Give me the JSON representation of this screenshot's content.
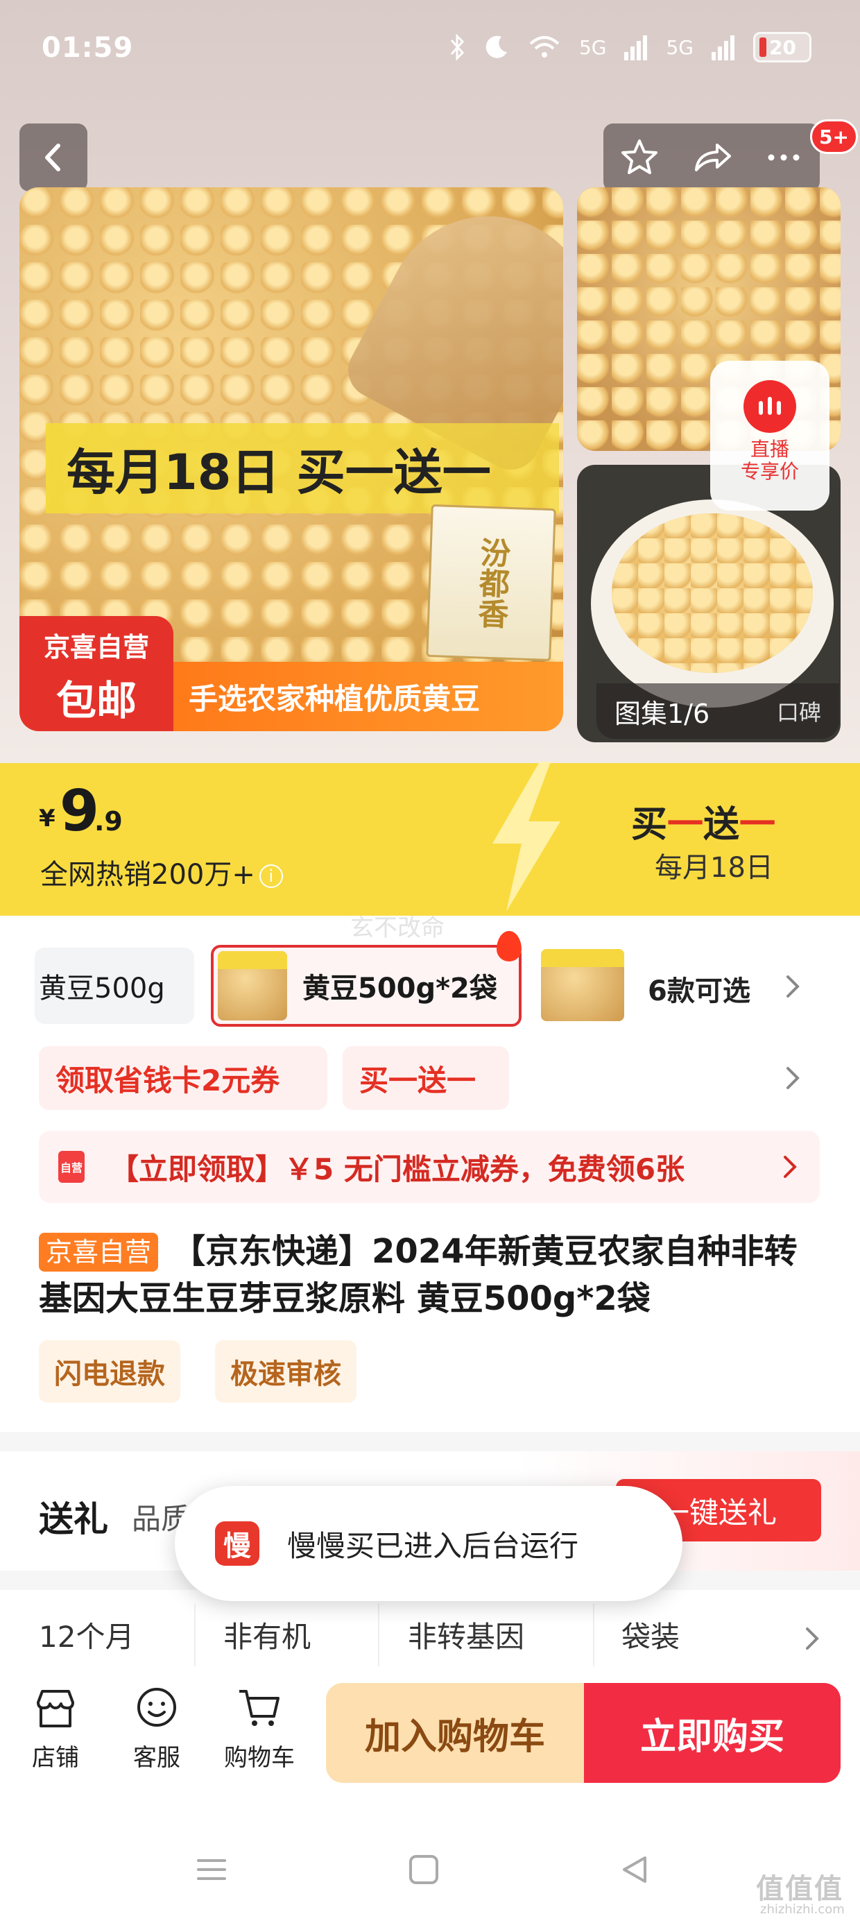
{
  "status_bar": {
    "time": "01:59",
    "network1": "5G",
    "network2": "5G",
    "battery": "20"
  },
  "header": {
    "badge": "5+"
  },
  "hero": {
    "promo_title": "每月18日 买一送一",
    "package_label": "汾都香",
    "shipping_top": "京喜自营",
    "shipping_bottom": "包邮",
    "shipping_strip": "手选农家种植优质黄豆",
    "gallery_label": "图集1/6",
    "reviews_label": "口碑",
    "live_label_1": "直播",
    "live_label_2": "专享价"
  },
  "price": {
    "currency": "¥",
    "integer": "9",
    "decimal": ".9",
    "sales": "全网热销200万+",
    "info_icon": "i",
    "bogo_1": "买",
    "bogo_2": "一",
    "bogo_3": "送",
    "bogo_4": "一",
    "bogo_date": "每月18日",
    "watermark": "玄不改命"
  },
  "variants": {
    "items": [
      "黄豆500g",
      "黄豆500g*2袋"
    ],
    "more": "6款可选"
  },
  "coupons": {
    "c1": "领取省钱卡2元券",
    "c2": "买一送一",
    "bar_tag": "自营",
    "bar_text": "【立即领取】￥5 无门槛立减券，免费领6张"
  },
  "product": {
    "seller_tag": "京喜自营",
    "title": "【京东快递】2024年新黄豆农家自种非转基因大豆生豆芽豆浆原料 黄豆500g*2袋",
    "chips": [
      "闪电退款",
      "极速审核"
    ]
  },
  "gift": {
    "heading": "送礼",
    "sub": "品质",
    "button": "一键送礼"
  },
  "params": [
    "12个月",
    "非有机",
    "非转基因",
    "袋装"
  ],
  "toast": {
    "icon_text": "慢",
    "text": "慢慢买已进入后台运行"
  },
  "bottom_bar": {
    "shop": "店铺",
    "service": "客服",
    "cart": "购物车",
    "add_cart": "加入购物车",
    "buy_now": "立即购买"
  },
  "corner_watermark": {
    "main": "值值值",
    "sub": "zhizhizhi.com"
  },
  "colors": {
    "accent_red": "#f22d43",
    "price_band": "#f9db40",
    "orange": "#ff7d22"
  }
}
